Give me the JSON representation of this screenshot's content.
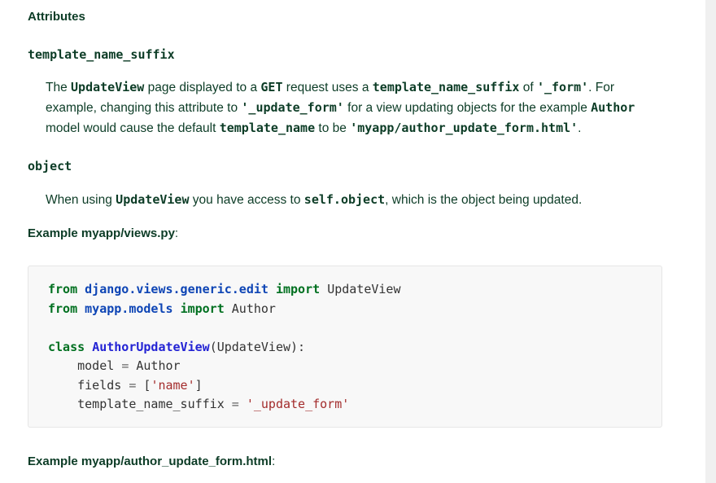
{
  "heading": "Attributes",
  "attr1": {
    "name": "template_name_suffix",
    "desc": {
      "t1": "The ",
      "c1": "UpdateView",
      "t2": " page displayed to a ",
      "c2": "GET",
      "t3": " request uses a ",
      "c3": "template_name_suffix",
      "t4": " of ",
      "c4": "'_form'",
      "t5": ". For example, changing this attribute to ",
      "c5": "'_update_form'",
      "t6": " for a view updating objects for the example ",
      "c6": "Author",
      "t7": " model would cause the default ",
      "c7": "template_name",
      "t8": " to be ",
      "c8": "'myapp/author_update_form.html'",
      "t9": "."
    }
  },
  "attr2": {
    "name": "object",
    "desc": {
      "t1": "When using ",
      "c1": "UpdateView",
      "t2": " you have access to ",
      "c2": "self.object",
      "t3": ", which is the object being updated."
    }
  },
  "example1": {
    "title": "Example myapp/views.py",
    "colon": ":"
  },
  "code": {
    "l1": {
      "kw1": "from",
      "mod": "django.views.generic.edit",
      "kw2": "import",
      "name": "UpdateView"
    },
    "l2": {
      "kw1": "from",
      "mod": "myapp.models",
      "kw2": "import",
      "name": "Author"
    },
    "l4": {
      "kw": "class",
      "cls": "AuthorUpdateView",
      "rest": "(UpdateView):"
    },
    "l5": {
      "lhs": "model",
      "op": "=",
      "rhs": "Author"
    },
    "l6": {
      "lhs": "fields",
      "op": "=",
      "open": "[",
      "str": "'name'",
      "close": "]"
    },
    "l7": {
      "lhs": "template_name_suffix",
      "op": "=",
      "str": "'_update_form'"
    }
  },
  "example2": {
    "title": "Example myapp/author_update_form.html",
    "colon": ":"
  },
  "colors": {
    "text": "#0c3c26",
    "keyword": "#007020",
    "string": "#a32c2c",
    "code_bg": "#f8f8f8"
  }
}
